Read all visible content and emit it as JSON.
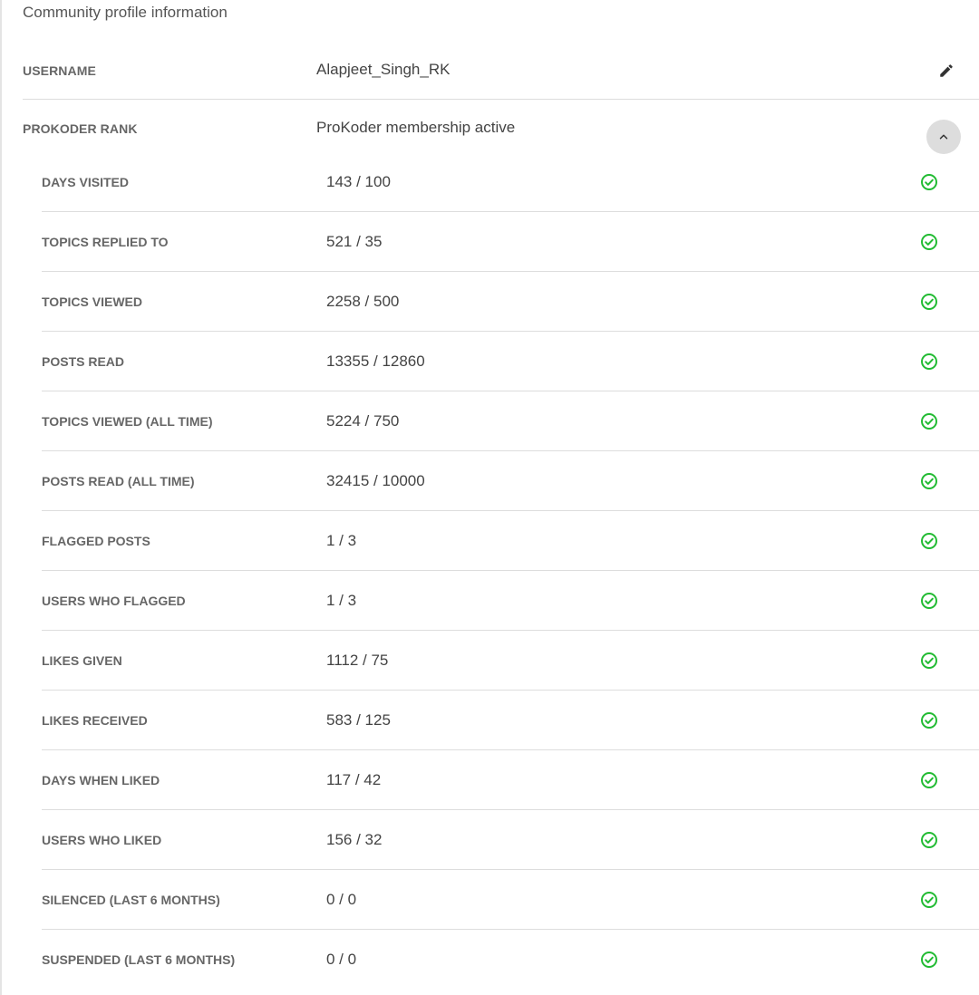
{
  "section_title": "Community profile information",
  "username": {
    "label": "USERNAME",
    "value": "Alapjeet_Singh_RK",
    "edit_icon": "pencil-icon"
  },
  "rank": {
    "label": "PROKODER RANK",
    "value": "ProKoder membership active",
    "toggle_icon": "chevron-up-icon"
  },
  "colors": {
    "check": "#22bb33",
    "divider": "#dddddd",
    "toggle_bg": "#dddddd"
  },
  "criteria": [
    {
      "label": "DAYS VISITED",
      "value": "143 / 100",
      "met": true
    },
    {
      "label": "TOPICS REPLIED TO",
      "value": "521 / 35",
      "met": true
    },
    {
      "label": "TOPICS VIEWED",
      "value": "2258 / 500",
      "met": true
    },
    {
      "label": "POSTS READ",
      "value": "13355 / 12860",
      "met": true
    },
    {
      "label": "TOPICS VIEWED (ALL TIME)",
      "value": "5224 / 750",
      "met": true
    },
    {
      "label": "POSTS READ (ALL TIME)",
      "value": "32415 / 10000",
      "met": true
    },
    {
      "label": "FLAGGED POSTS",
      "value": "1 / 3",
      "met": true
    },
    {
      "label": "USERS WHO FLAGGED",
      "value": "1 / 3",
      "met": true
    },
    {
      "label": "LIKES GIVEN",
      "value": "1112 / 75",
      "met": true
    },
    {
      "label": "LIKES RECEIVED",
      "value": "583 / 125",
      "met": true
    },
    {
      "label": "DAYS WHEN LIKED",
      "value": "117 / 42",
      "met": true
    },
    {
      "label": "USERS WHO LIKED",
      "value": "156 / 32",
      "met": true
    },
    {
      "label": "SILENCED (LAST 6 MONTHS)",
      "value": "0 / 0",
      "met": true
    },
    {
      "label": "SUSPENDED (LAST 6 MONTHS)",
      "value": "0 / 0",
      "met": true
    }
  ]
}
